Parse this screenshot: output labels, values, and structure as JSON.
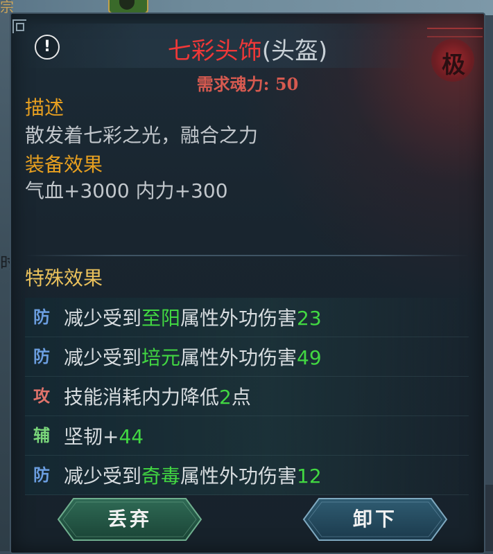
{
  "item": {
    "name": "七彩头饰",
    "type": "(头盔)",
    "requirement": "需求魂力: 50",
    "rank_char": "极"
  },
  "description": {
    "label": "描述",
    "text": "散发着七彩之光，融合之力"
  },
  "equip_effect": {
    "label": "装备效果",
    "text": "气血+3000  内力+300"
  },
  "special": {
    "label": "特殊效果",
    "effects": [
      {
        "badge": "防",
        "kind": "def",
        "prefix": "减少受到",
        "highlight": "至阳",
        "middle": "属性外功伤害",
        "value": "23"
      },
      {
        "badge": "防",
        "kind": "def",
        "prefix": "减少受到",
        "highlight": "培元",
        "middle": "属性外功伤害",
        "value": "49"
      },
      {
        "badge": "攻",
        "kind": "atk",
        "prefix": "技能消耗内力降低",
        "highlight": "",
        "middle": "",
        "value": "2",
        "suffix": "点"
      },
      {
        "badge": "辅",
        "kind": "sup",
        "prefix": "坚韧+",
        "highlight": "",
        "middle": "",
        "value": "44"
      },
      {
        "badge": "防",
        "kind": "def",
        "prefix": "减少受到",
        "highlight": "奇毒",
        "middle": "属性外功伤害",
        "value": "12"
      }
    ]
  },
  "buttons": {
    "discard": "丢弃",
    "unequip": "卸下"
  },
  "background": {
    "corner_text": "宗",
    "left_text": "时"
  },
  "colors": {
    "item_name": "#ef3838",
    "section_label": "#e8a020",
    "highlight": "#42d842",
    "requirement": "#d65a50"
  }
}
